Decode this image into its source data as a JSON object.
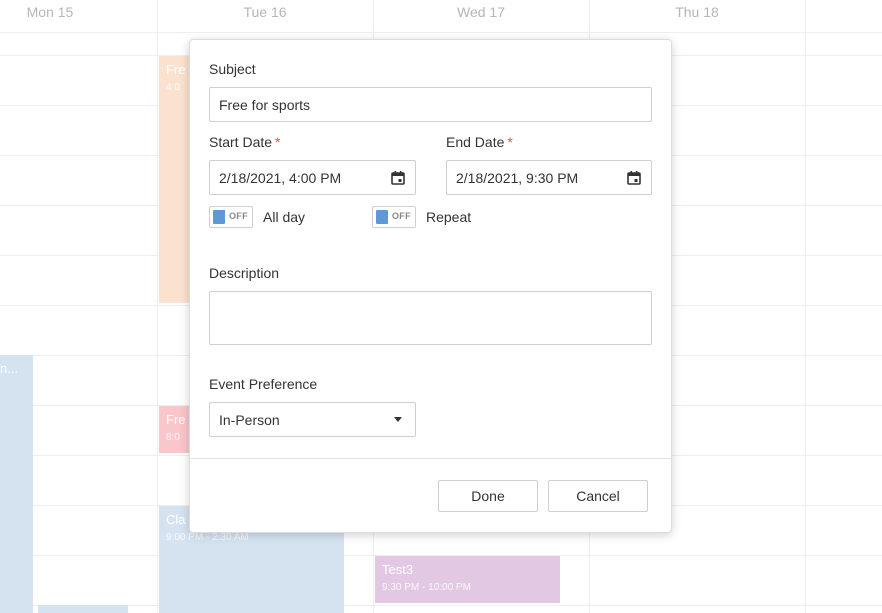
{
  "calendar": {
    "days": [
      "Mon 15",
      "Tue 16",
      "Wed 17",
      "Thu 18"
    ],
    "events": [
      {
        "title": "Fre",
        "time": "4:0",
        "color": "#fbe2cf"
      },
      {
        "title": "n...",
        "time": "",
        "color": "#d5e3f1"
      },
      {
        "title": "Fre",
        "time": "8:0",
        "color": "#f8c6cb"
      },
      {
        "title": "Cla",
        "time": "9:00 PM - 2:30 AM",
        "color": "#d5e3f1"
      },
      {
        "title": "Test3",
        "time": "9:30 PM - 10:00 PM",
        "color": "#e3c8e3"
      },
      {
        "title": "",
        "time": "",
        "color": "#d5e3f1"
      }
    ]
  },
  "dialog": {
    "subject_label": "Subject",
    "subject_value": "Free for sports",
    "start_label": "Start Date",
    "start_value": "2/18/2021, 4:00 PM",
    "end_label": "End Date",
    "end_value": "2/18/2021, 9:30 PM",
    "required_mark": "*",
    "allday_toggle_state": "OFF",
    "allday_label": "All day",
    "repeat_toggle_state": "OFF",
    "repeat_label": "Repeat",
    "description_label": "Description",
    "description_value": "",
    "preference_label": "Event Preference",
    "preference_value": "In-Person",
    "done_label": "Done",
    "cancel_label": "Cancel"
  },
  "colors": {
    "toggle_knob": "#5c99d6",
    "required": "#d9534f"
  },
  "icons": {
    "date_picker": "calendar-icon",
    "dropdown": "chevron-down-icon"
  }
}
